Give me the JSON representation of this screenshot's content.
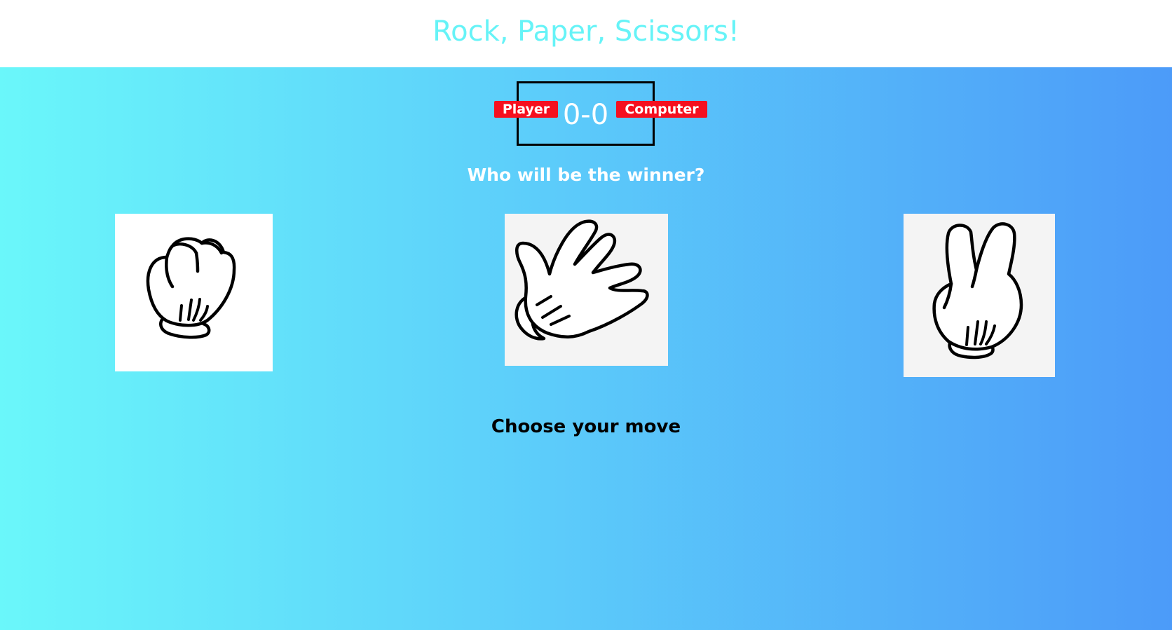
{
  "header": {
    "title": "Rock, Paper, Scissors!"
  },
  "scoreboard": {
    "player_label": "Player",
    "computer_label": "Computer",
    "player_score": 0,
    "computer_score": 0,
    "score_text": "0-0"
  },
  "status": {
    "message": "Who will be the winner?"
  },
  "choices": [
    {
      "name": "rock",
      "icon": "rock-fist-icon"
    },
    {
      "name": "paper",
      "icon": "paper-hand-icon"
    },
    {
      "name": "scissors",
      "icon": "scissors-hand-icon"
    }
  ],
  "prompt": "Choose your move",
  "colors": {
    "title": "#66f3f7",
    "gradient_start": "#6af7fa",
    "gradient_end": "#4c9bf9",
    "badge": "#f5101f"
  }
}
